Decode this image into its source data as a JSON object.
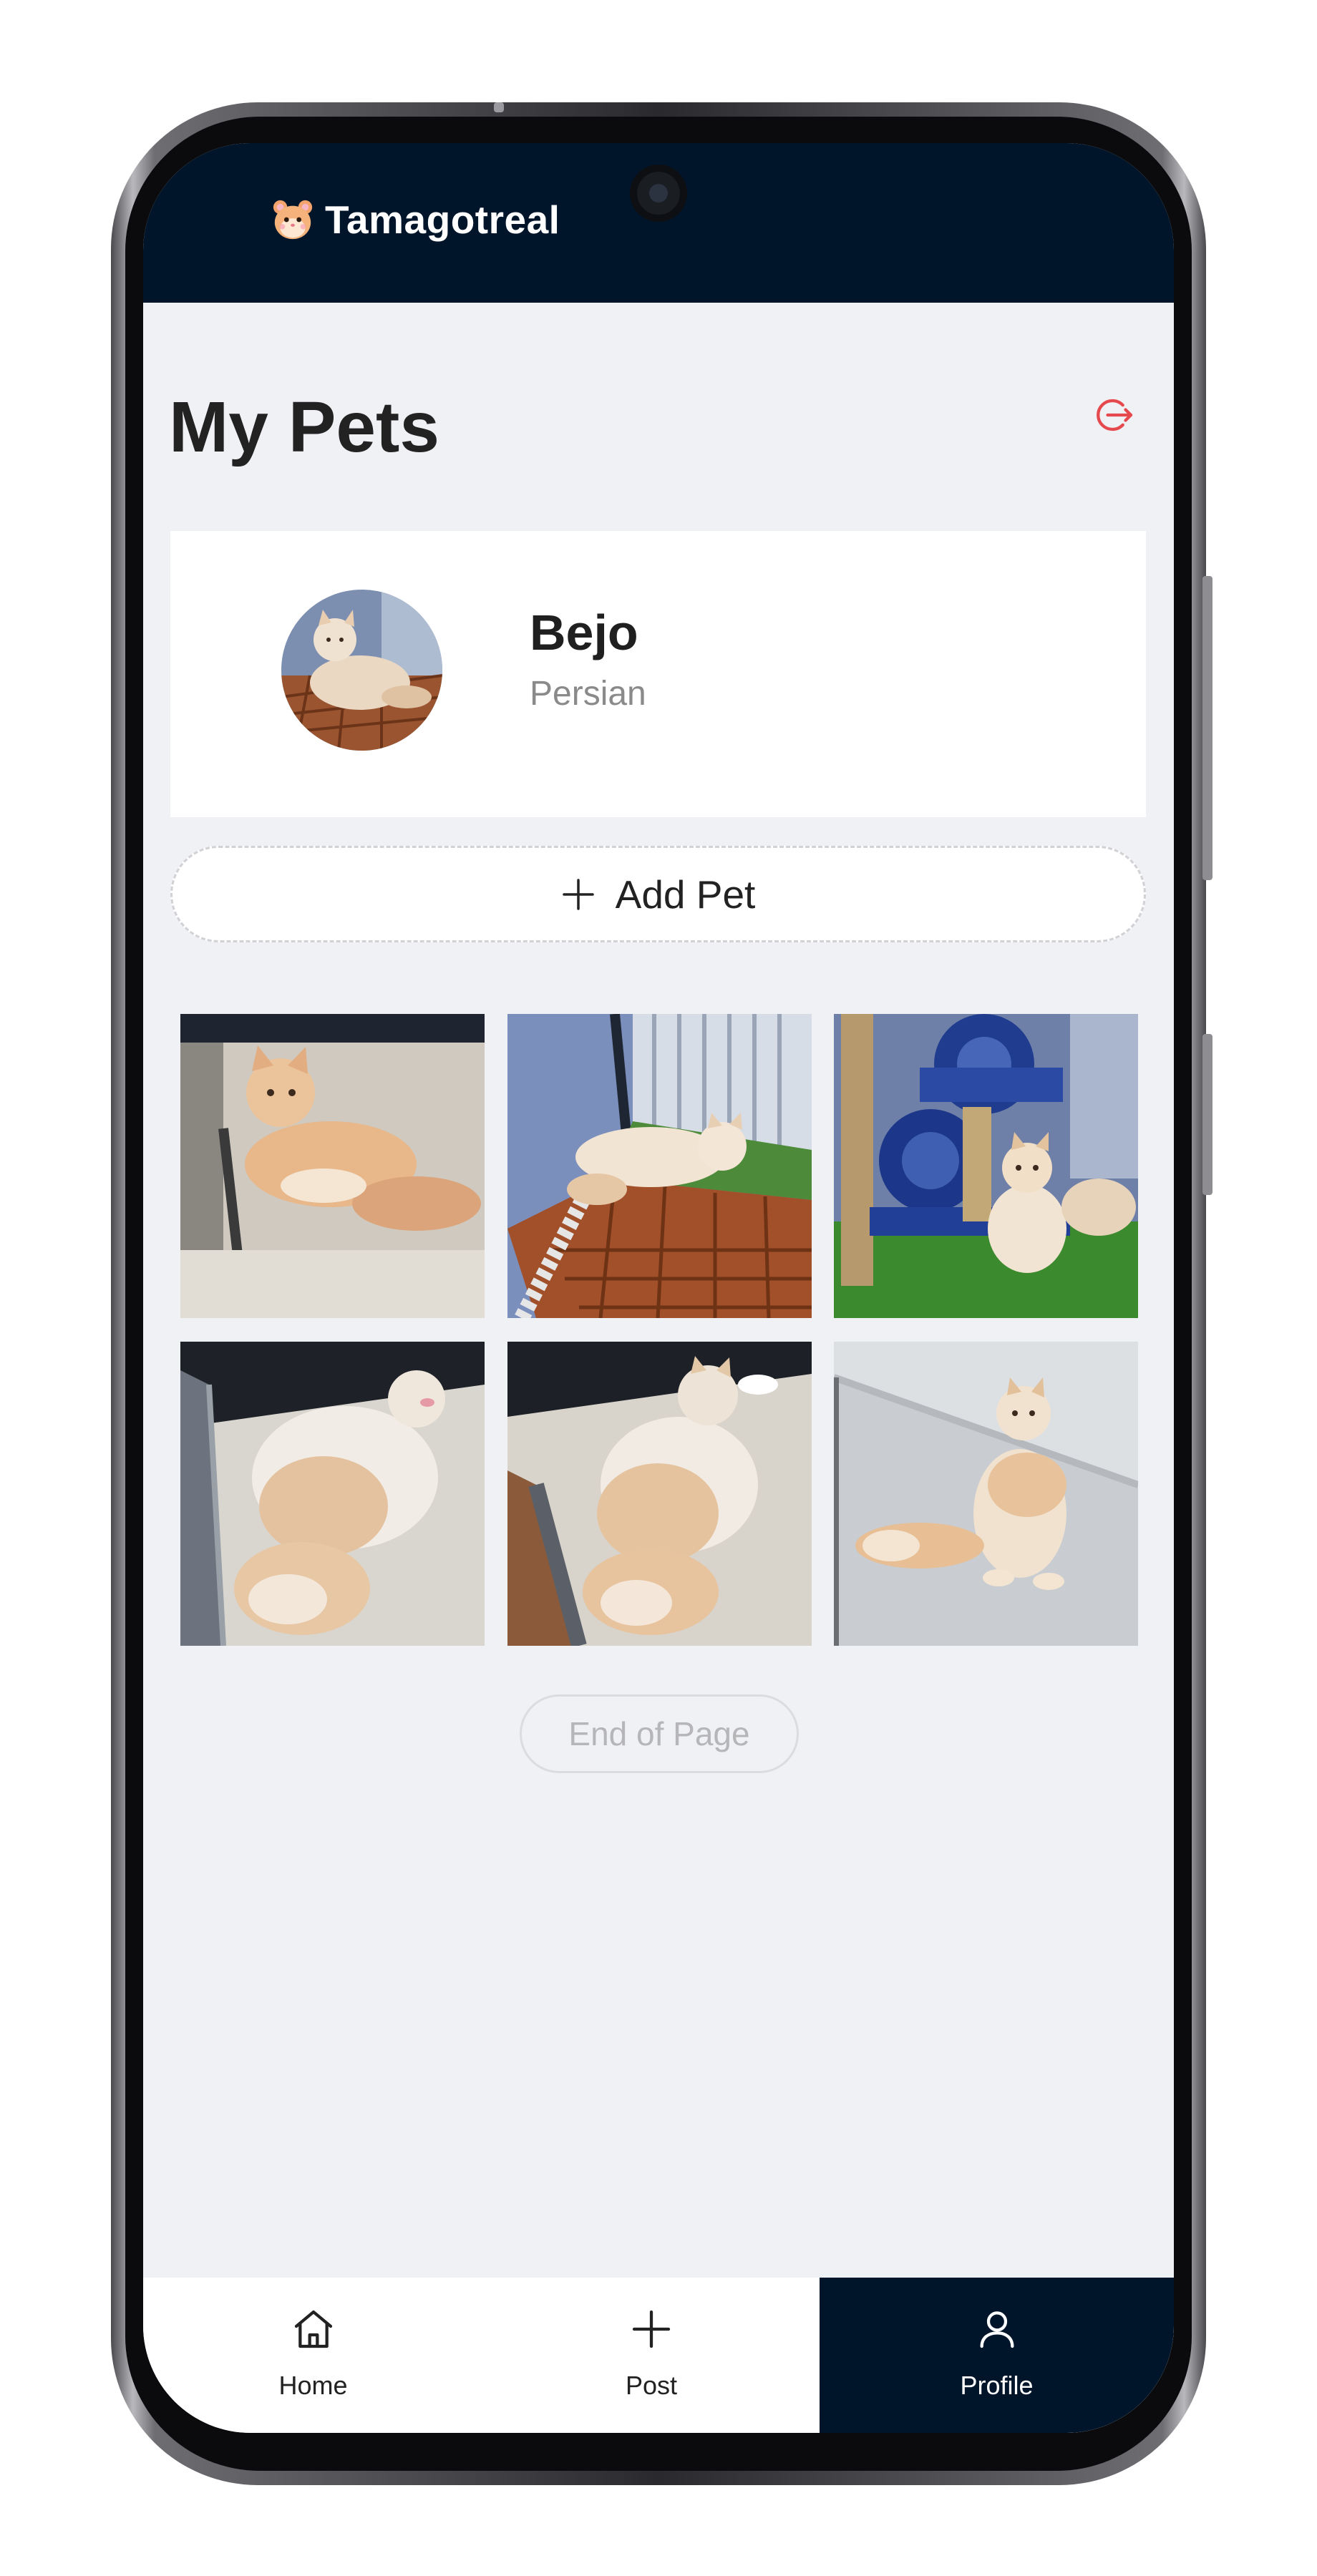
{
  "app": {
    "name": "Tamagotreal",
    "logo_icon": "hamster-face-icon"
  },
  "page": {
    "title": "My Pets",
    "logout_icon": "logout-icon"
  },
  "pet": {
    "name": "Bejo",
    "breed": "Persian"
  },
  "actions": {
    "add_pet_label": "Add Pet"
  },
  "gallery": {
    "photos": [
      {
        "label": "cat-photo-1"
      },
      {
        "label": "cat-photo-2"
      },
      {
        "label": "cat-photo-3"
      },
      {
        "label": "cat-photo-4"
      },
      {
        "label": "cat-photo-5"
      },
      {
        "label": "cat-photo-6"
      }
    ]
  },
  "footer": {
    "end_label": "End of Page"
  },
  "nav": {
    "items": [
      {
        "label": "Home",
        "icon": "home-icon",
        "active": false
      },
      {
        "label": "Post",
        "icon": "plus-icon",
        "active": false
      },
      {
        "label": "Profile",
        "icon": "user-icon",
        "active": true
      }
    ]
  },
  "colors": {
    "header_bg": "#00152a",
    "page_bg": "#f0f1f5",
    "logout_red": "#e5484d",
    "active_nav_bg": "#00152a"
  }
}
